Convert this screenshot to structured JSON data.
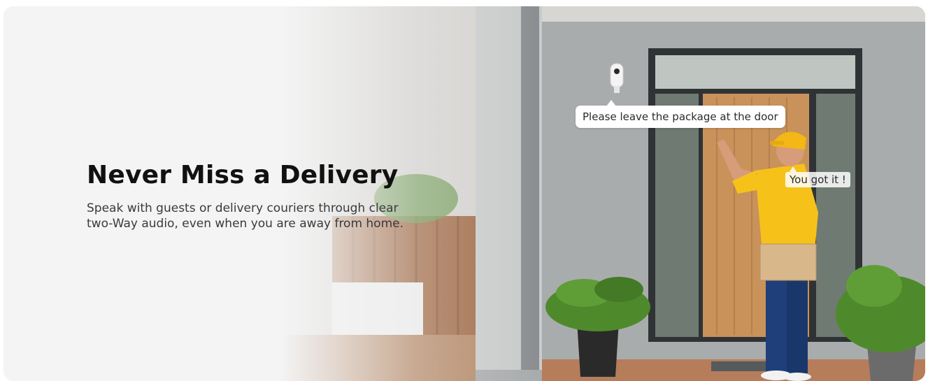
{
  "hero": {
    "headline": "Never Miss a Delivery",
    "subtext": "Speak with guests or delivery couriers through clear two-Way audio, even when you are away from home."
  },
  "speech": {
    "camera_message": "Please leave the package at the door",
    "courier_reply": "You got it !"
  },
  "colors": {
    "background": "#f3f3f3",
    "headline": "#111111",
    "body_text": "#3a3a3a",
    "wall": "#a9acad",
    "door_wood": "#c8925a",
    "uniform_yellow": "#f6c21a",
    "jeans": "#1f3f7a",
    "plant_green": "#4e8a2c"
  }
}
